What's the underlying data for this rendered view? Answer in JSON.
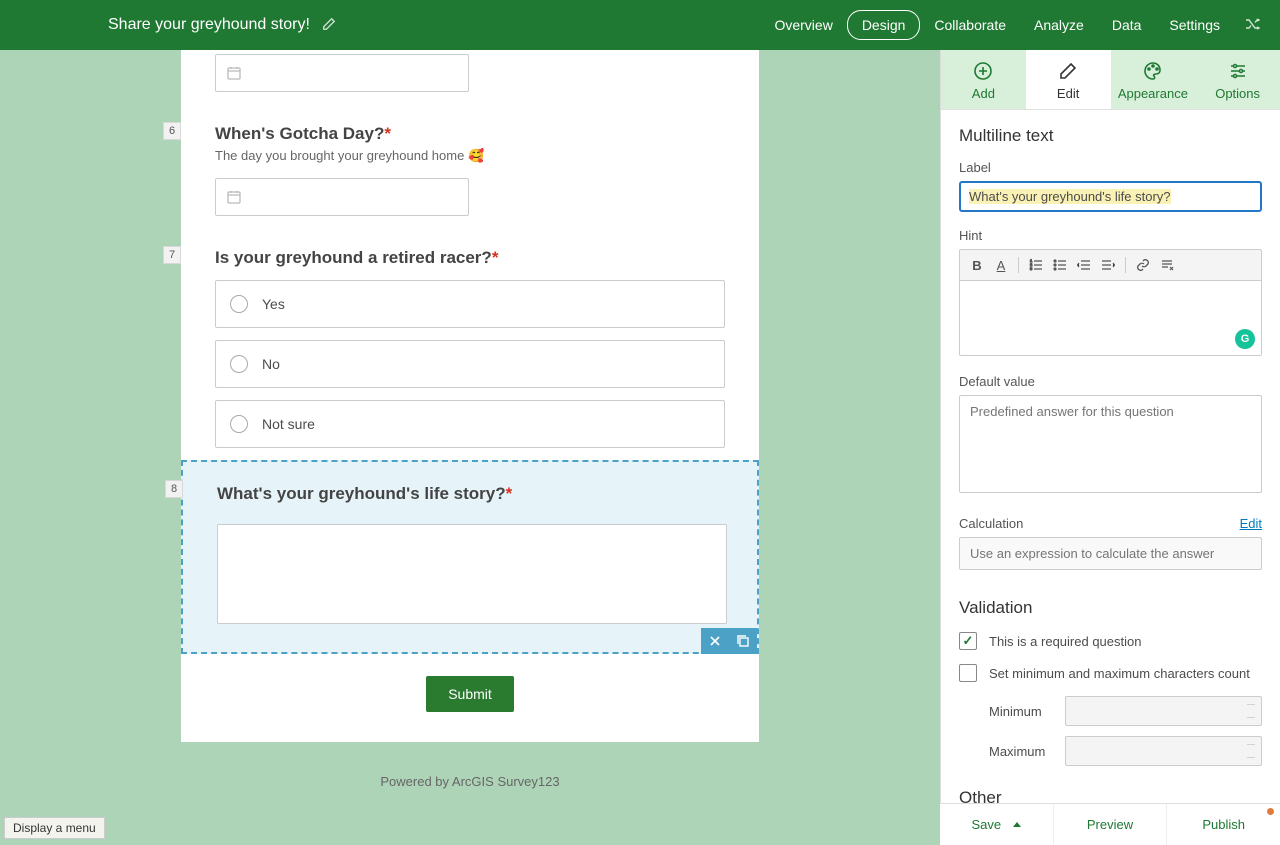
{
  "header": {
    "title": "Share your greyhound story!",
    "nav": [
      "Overview",
      "Design",
      "Collaborate",
      "Analyze",
      "Data",
      "Settings"
    ],
    "active_nav": "Design"
  },
  "form": {
    "q6": {
      "num": "6",
      "label": "When's Gotcha Day?",
      "hint": "The day you brought your greyhound home 🥰"
    },
    "q7": {
      "num": "7",
      "label": "Is your greyhound a retired racer?",
      "options": [
        "Yes",
        "No",
        "Not sure"
      ]
    },
    "q8": {
      "num": "8",
      "label": "What's your greyhound's life story?"
    },
    "submit": "Submit",
    "powered": "Powered by ArcGIS Survey123"
  },
  "panel": {
    "tabs": {
      "add": "Add",
      "edit": "Edit",
      "appearance": "Appearance",
      "options": "Options"
    },
    "section_title": "Multiline text",
    "label_field": {
      "label": "Label",
      "value": "What's your greyhound's life story?"
    },
    "hint_label": "Hint",
    "default_label": "Default value",
    "default_placeholder": "Predefined answer for this question",
    "calc_label": "Calculation",
    "calc_edit": "Edit",
    "calc_placeholder": "Use an expression to calculate the answer",
    "validation_title": "Validation",
    "required_label": "This is a required question",
    "minmax_label": "Set minimum and maximum characters count",
    "min_label": "Minimum",
    "max_label": "Maximum",
    "other_title": "Other"
  },
  "actions": {
    "save": "Save",
    "preview": "Preview",
    "publish": "Publish"
  },
  "status_tip": "Display a menu"
}
